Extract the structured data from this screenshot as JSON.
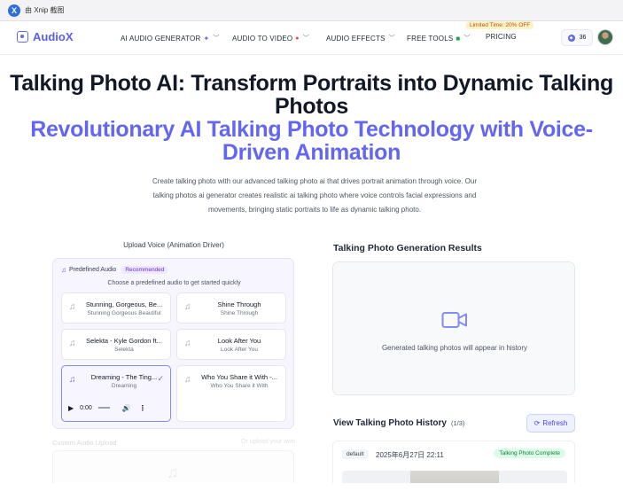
{
  "xnip": {
    "logo": "X",
    "title": "由 Xnip 截图"
  },
  "nav": {
    "brand": "AudioX",
    "items": [
      {
        "label": "AI AUDIO GENERATOR"
      },
      {
        "label": "AUDIO TO VIDEO"
      },
      {
        "label": "AUDIO EFFECTS"
      },
      {
        "label": "FREE TOOLS"
      },
      {
        "label": "PRICING"
      }
    ],
    "promo": "Limited Time: 20% OFF",
    "credits": "36"
  },
  "hero": {
    "title": "Talking Photo AI: Transform Portraits into Dynamic Talking Photos",
    "subtitle": "Revolutionary AI Talking Photo Technology with Voice-Driven Animation",
    "description": "Create talking photo with our advanced talking photo ai that drives portrait animation through voice. Our talking photos ai generator creates realistic ai talking photo where voice controls facial expressions and movements, bringing static portraits to life as dynamic talking photo."
  },
  "upload": {
    "title": "Upload Voice (Animation Driver)",
    "predefined_label": "Predefined Audio",
    "recommended": "Recommended",
    "hint": "Choose a predefined audio to get started quickly",
    "tracks": [
      {
        "title": "Stunning, Gorgeous, Be...",
        "artist": "Stunning Gorgeous Beautiful"
      },
      {
        "title": "Shine Through",
        "artist": "Shine Through"
      },
      {
        "title": "Selekta - Kyle Gordon ft...",
        "artist": "Selekta"
      },
      {
        "title": "Look After You",
        "artist": "Look After You"
      },
      {
        "title": "Dreaming - The Ting...",
        "artist": "Dreaming"
      },
      {
        "title": "Who You Share it With -...",
        "artist": "Who You Share it With"
      }
    ],
    "player_time": "0:00",
    "custom_label": "Custom Audio Upload",
    "custom_hint": "Or upload your own"
  },
  "results": {
    "title": "Talking Photo Generation Results",
    "empty_text": "Generated talking photos will appear in history"
  },
  "history": {
    "title": "View Talking Photo History",
    "count": "(1/3)",
    "refresh": "Refresh",
    "item": {
      "tag": "default",
      "date": "2025年6月27日 22:11",
      "status": "Talking Photo Complete"
    }
  }
}
